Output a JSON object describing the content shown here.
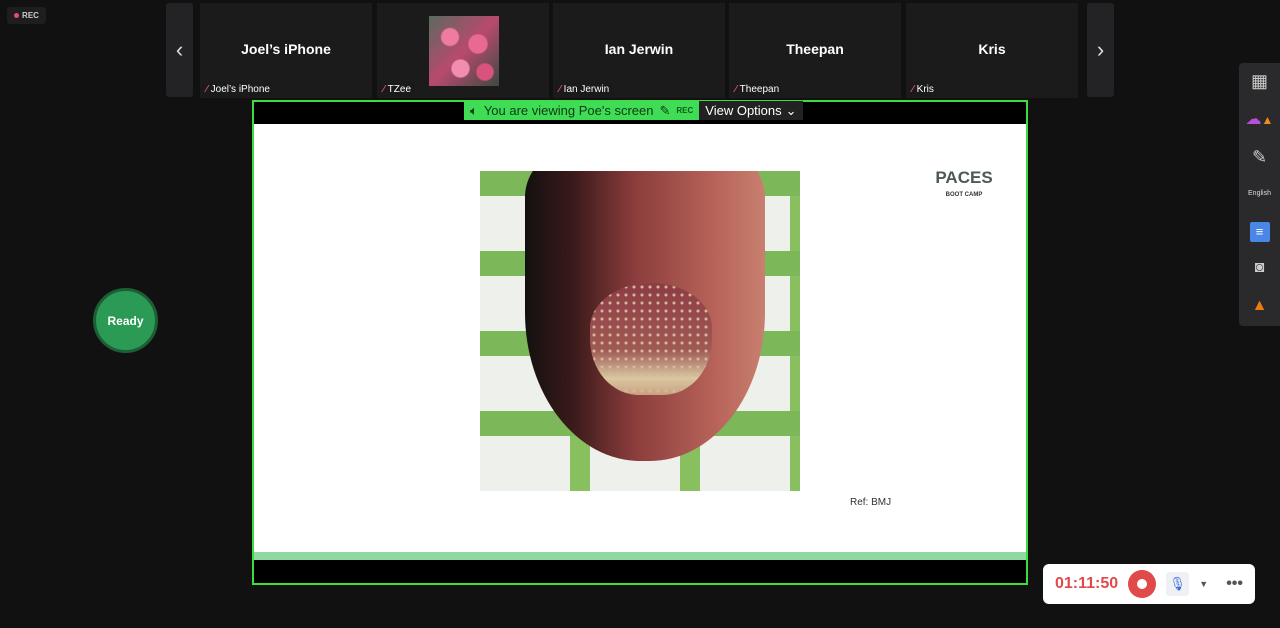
{
  "recording_badge": "REC",
  "participants": [
    {
      "tile_name": "Joel’s iPhone",
      "label": "Joel’s iPhone"
    },
    {
      "tile_name": "",
      "label": "TZee"
    },
    {
      "tile_name": "Ian Jerwin",
      "label": "Ian Jerwin"
    },
    {
      "tile_name": "Theepan",
      "label": "Theepan"
    },
    {
      "tile_name": "Kris",
      "label": "Kris"
    }
  ],
  "share_banner": {
    "text": "You are viewing Poe's screen",
    "rec": "REC",
    "view_options": "View Options"
  },
  "slide": {
    "logo_title": "PACES",
    "logo_subtitle": "BOOT CAMP",
    "reference": "Ref: BMJ"
  },
  "ready_button": "Ready",
  "toolbar": {
    "language": "English"
  },
  "controls": {
    "timer": "01:11:50"
  },
  "colors": {
    "accent_green": "#3fdc3f",
    "record_red": "#e04a4a"
  }
}
